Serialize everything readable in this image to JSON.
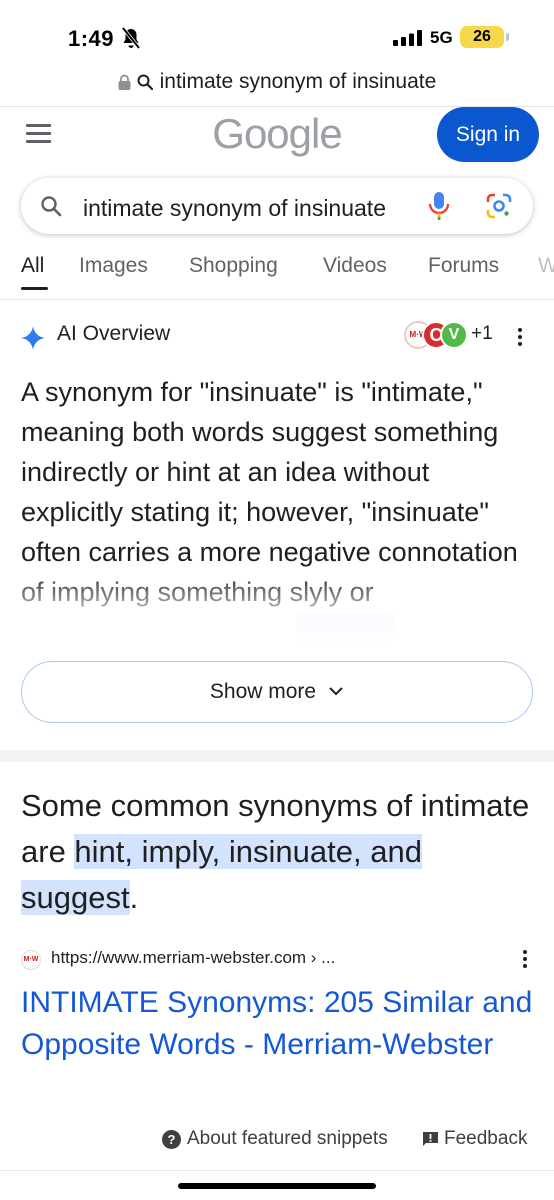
{
  "status_bar": {
    "time": "1:49",
    "network": "5G",
    "battery": "26"
  },
  "url_bar": {
    "text": "intimate synonym of insinuate"
  },
  "header": {
    "logo": "Google",
    "signin_label": "Sign in"
  },
  "search": {
    "query": "intimate synonym of insinuate"
  },
  "tabs": [
    {
      "label": "All"
    },
    {
      "label": "Images"
    },
    {
      "label": "Shopping"
    },
    {
      "label": "Videos"
    },
    {
      "label": "Forums"
    },
    {
      "label": "W"
    }
  ],
  "ai_overview": {
    "title": "AI Overview",
    "source_icons": [
      {
        "label": "M·W",
        "color": "#c41e1e"
      },
      {
        "label": "C",
        "color": "#d62d2d"
      },
      {
        "label": "V",
        "color": "#52b848"
      }
    ],
    "more_sources": "+1",
    "text": "A synonym for \"insinuate\" is \"intimate,\" meaning both words suggest something indirectly or hint at an idea without explicitly stating it; however, \"insinuate\" often carries a more negative connotation of implying something slyly or",
    "show_more": "Show more"
  },
  "snippet": {
    "text_before": "Some common synonyms of intimate are ",
    "highlight": "hint, imply, insinuate, and suggest",
    "text_after": ".",
    "favicon": "M·W",
    "url": "https://www.merriam-webster.com › ...",
    "title": "INTIMATE Synonyms: 205 Similar and Opposite Words - Merriam-Webster"
  },
  "footer": {
    "about": "About featured snippets",
    "feedback": "Feedback"
  }
}
